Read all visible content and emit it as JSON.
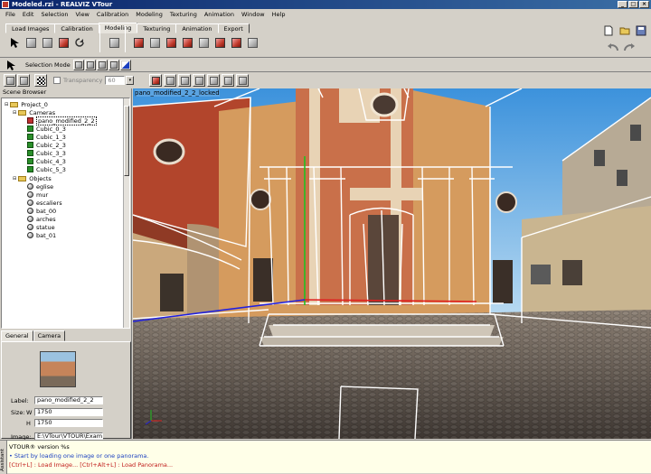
{
  "window": {
    "title": "Modeled.rzi - REALVIZ VTour"
  },
  "menu": [
    "File",
    "Edit",
    "Selection",
    "View",
    "Calibration",
    "Modeling",
    "Texturing",
    "Animation",
    "Window",
    "Help"
  ],
  "workflow_tabs": [
    "Load Images",
    "Calibration",
    "Modeling",
    "Texturing",
    "Animation",
    "Export"
  ],
  "active_tab": "Modeling",
  "toolbar": {
    "selection_mode_label": "Selection Mode",
    "transparency_label": "Transparency",
    "transparency_value": "60"
  },
  "scene_browser": {
    "title": "Scene Browser",
    "project": "Project_0",
    "cameras_label": "Cameras",
    "cameras": [
      "pano_modified_2_2",
      "Cubic_0_3",
      "Cubic_1_3",
      "Cubic_2_3",
      "Cubic_3_3",
      "Cubic_4_3",
      "Cubic_5_3"
    ],
    "objects_label": "Objects",
    "objects": [
      "eglise",
      "mur",
      "escaliers",
      "bat_00",
      "arches",
      "statue",
      "bat_01"
    ]
  },
  "properties": {
    "tabs": [
      "General",
      "Camera"
    ],
    "label_caption": "Label:",
    "label_value": "pano_modified_2_2",
    "size_caption": "Size:",
    "w_caption": "W",
    "w_value": "1750",
    "h_caption": "H",
    "h_value": "1750",
    "image_caption": "Image:",
    "image_value": "E:\\VTour\\VTOUR\\Exampl"
  },
  "viewport": {
    "label": "pano_modified_2_2_locked"
  },
  "assistant": {
    "side_label": "Assistant",
    "line1": "VTOUR® version %s",
    "line2": "• Start by loading one image or one panorama.",
    "line3": "[Ctrl+L] : Load Image...   [Ctrl+Alt+L] : Load Panorama..."
  },
  "colors": {
    "titlebar": "#0a246a",
    "wireframe": "#ffffff",
    "axis_x": "#e02020",
    "axis_y": "#20c020",
    "axis_z": "#2020e0"
  }
}
